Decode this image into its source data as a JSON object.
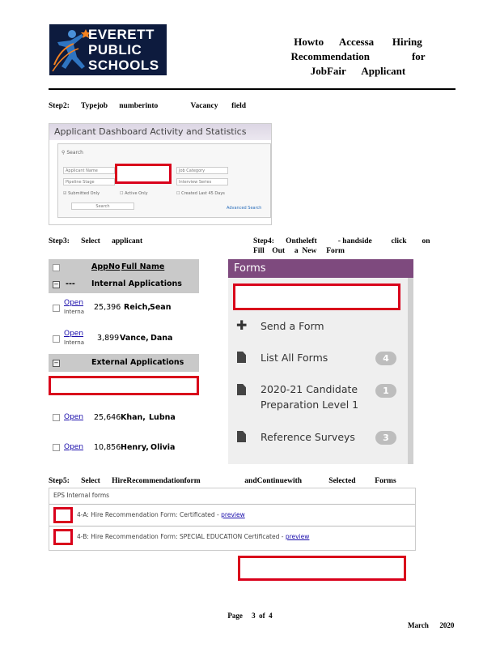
{
  "logo": {
    "line1": "EVERETT",
    "line2": "PUBLIC",
    "line3": "SCHOOLS",
    "color_bg": "#0d1b3e",
    "accent": "#f58220"
  },
  "title": {
    "line1": "Howto      Accessa       Hiring",
    "line2": "Recommendation                for",
    "line3": "JobFair      Applicant"
  },
  "step2": {
    "caption": "Step2:      Typejob      numberinto                 Vacancy       field"
  },
  "shot1": {
    "header": "Applicant Dashboard Activity and Statistics",
    "search_label": "Search",
    "applicant_name": "Applicant Name",
    "job_category": "Job Category",
    "pipeline_stage": "Pipeline Stage",
    "interview_series": "Interview Series",
    "submitted_only": "Submitted Only",
    "active_only": "Active Only",
    "created_last": "Created Last 45 Days",
    "search_button": "Search",
    "advanced_search": "Advanced Search"
  },
  "step3": {
    "caption": "Step3:      Select      applicant"
  },
  "step4": {
    "caption_line1": "Step4:      Ontheleft           - handside          click        on",
    "caption_line2": "Fill    Out     a  New     Form"
  },
  "applicants": {
    "col_appno": "AppNo",
    "col_fullname": "Full Name",
    "internal_label": "Internal Applications",
    "external_label": "External Applications",
    "dashes": "---",
    "open": "Open",
    "internal_small": "Interna",
    "rows": [
      {
        "appno": "25,396",
        "last": "Reich,",
        "first": "Sean"
      },
      {
        "appno": "3,899",
        "last": "Vance,",
        "first": "Dana"
      },
      {
        "appno": "25,646",
        "last": "Khan,",
        "first": "Lubna"
      },
      {
        "appno": "10,856",
        "last": "Henry,",
        "first": "Olivia"
      }
    ]
  },
  "forms": {
    "header": "Forms",
    "send": "Send a Form",
    "list_all": "List All Forms",
    "list_all_count": "4",
    "candidate_line1": "2020-21 Candidate",
    "candidate_line2": "Preparation Level 1",
    "candidate_count": "1",
    "reference": "Reference Surveys",
    "reference_count": "3",
    "header_color": "#7e4a7e"
  },
  "step5": {
    "caption": "Step5:      Select      HireRecommendationform                       andContinuewith              Selected          Forms"
  },
  "shot4": {
    "title": "EPS Internal forms",
    "row1_prefix": "4-A: Hire Recommendation Form: Certificated -",
    "row2_prefix": "4-B: Hire Recommendation Form: SPECIAL EDUCATION Certificated -",
    "preview": "preview"
  },
  "footer": {
    "page": "Page     3  of  4",
    "date": "March      2020"
  },
  "highlight_color": "#d9001b"
}
